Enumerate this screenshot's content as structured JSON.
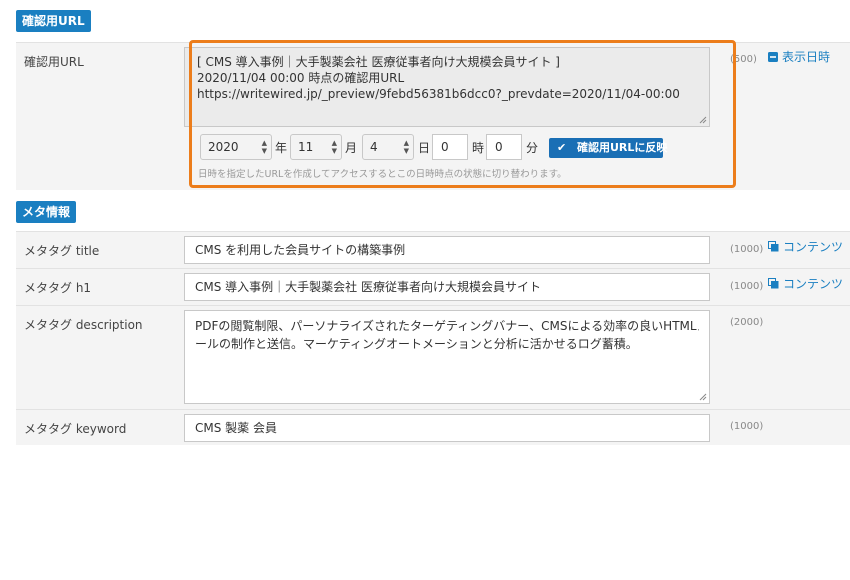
{
  "preview_section": {
    "tag": "確認用URL",
    "row_label": "確認用URL",
    "url_lines": [
      "[ CMS 導入事例｜大手製薬会社 医療従事者向け大規模会員サイト ]",
      "2020/11/04 00:00 時点の確認用URL",
      "https://writewired.jp/_preview/9febd56381b6dcc0?_prevdate=2020/11/04-00:00"
    ],
    "count": "(500)",
    "side_link": "表示日時",
    "year": "2020",
    "year_unit": "年",
    "month": "11",
    "month_unit": "月",
    "day": "4",
    "day_unit": "日",
    "hour": "0",
    "hour_unit": "時",
    "minute": "0",
    "minute_unit": "分",
    "apply_button": "確認用URLに反映",
    "help_text": "日時を指定したURLを作成してアクセスするとこの日時時点の状態に切り替わります。",
    "highlight_color": "#ec7d1b"
  },
  "meta_section": {
    "tag": "メタ情報",
    "title": {
      "label": "メタタグ title",
      "value": "CMS を利用した会員サイトの構築事例",
      "count": "(1000)",
      "link": "コンテンツ"
    },
    "h1": {
      "label": "メタタグ h1",
      "value": "CMS 導入事例｜大手製薬会社 医療従事者向け大規模会員サイト",
      "count": "(1000)",
      "link": "コンテンツ"
    },
    "description": {
      "label": "メタタグ description",
      "lines": [
        "PDFの閲覧制限、パーソナライズされたターゲティングバナー、CMSによる効率の良いHTMLメ",
        "ールの制作と送信。マーケティングオートメーションと分析に活かせるログ蓄積。"
      ],
      "count": "(2000)"
    },
    "keyword": {
      "label": "メタタグ keyword",
      "value": "CMS 製薬 会員",
      "count": "(1000)"
    }
  },
  "colors": {
    "accent": "#1a7fc1",
    "button": "#1a6fb5"
  }
}
